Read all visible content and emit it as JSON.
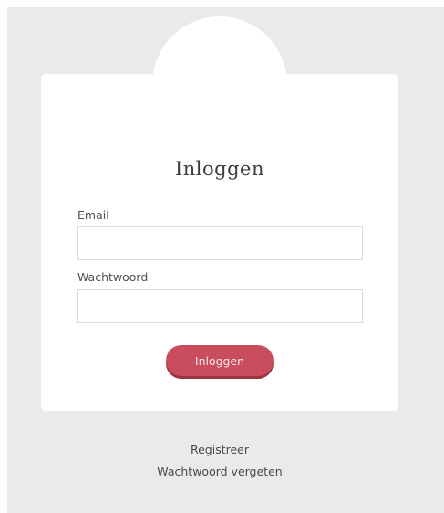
{
  "login": {
    "title": "Inloggen",
    "email_label": "Email",
    "email_value": "",
    "password_label": "Wachtwoord",
    "password_value": "",
    "submit_label": "Inloggen"
  },
  "footer": {
    "register_label": "Registreer",
    "forgot_password_label": "Wachtwoord vergeten"
  },
  "colors": {
    "background": "#ebeae8",
    "card": "#ffffff",
    "button": "#c94d5c"
  }
}
